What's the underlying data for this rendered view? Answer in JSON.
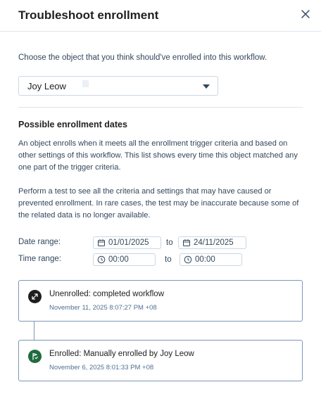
{
  "modal": {
    "title": "Troubleshoot enrollment",
    "intro": "Choose the object that you think should've enrolled into this workflow.",
    "selected_object": "Joy Leow",
    "section_title": "Possible enrollment dates",
    "paragraph1": "An object enrolls when it meets all the enrollment trigger criteria and based on other settings of this workflow. This list shows every time this object matched any one part of the trigger criteria.",
    "paragraph2": "Perform a test to see all the criteria and settings that may have caused or prevented enrollment. In rare cases, the test may be inaccurate because some of the related data is no longer available."
  },
  "filters": {
    "date_label": "Date range:",
    "date_from": "01/01/2025",
    "date_to": "24/11/2025",
    "time_label": "Time range:",
    "time_from": "00:00",
    "time_to": "00:00",
    "to_label": "to"
  },
  "events": [
    {
      "title": "Unenrolled: completed workflow",
      "timestamp": "November 11, 2025 8:07:27 PM +08",
      "icon": "unenroll-icon",
      "color": "#1e1e1e"
    },
    {
      "title": "Enrolled: Manually enrolled by Joy Leow",
      "timestamp": "November 6, 2025 8:01:33 PM +08",
      "icon": "enroll-icon",
      "color": "#1f6b3f"
    }
  ]
}
